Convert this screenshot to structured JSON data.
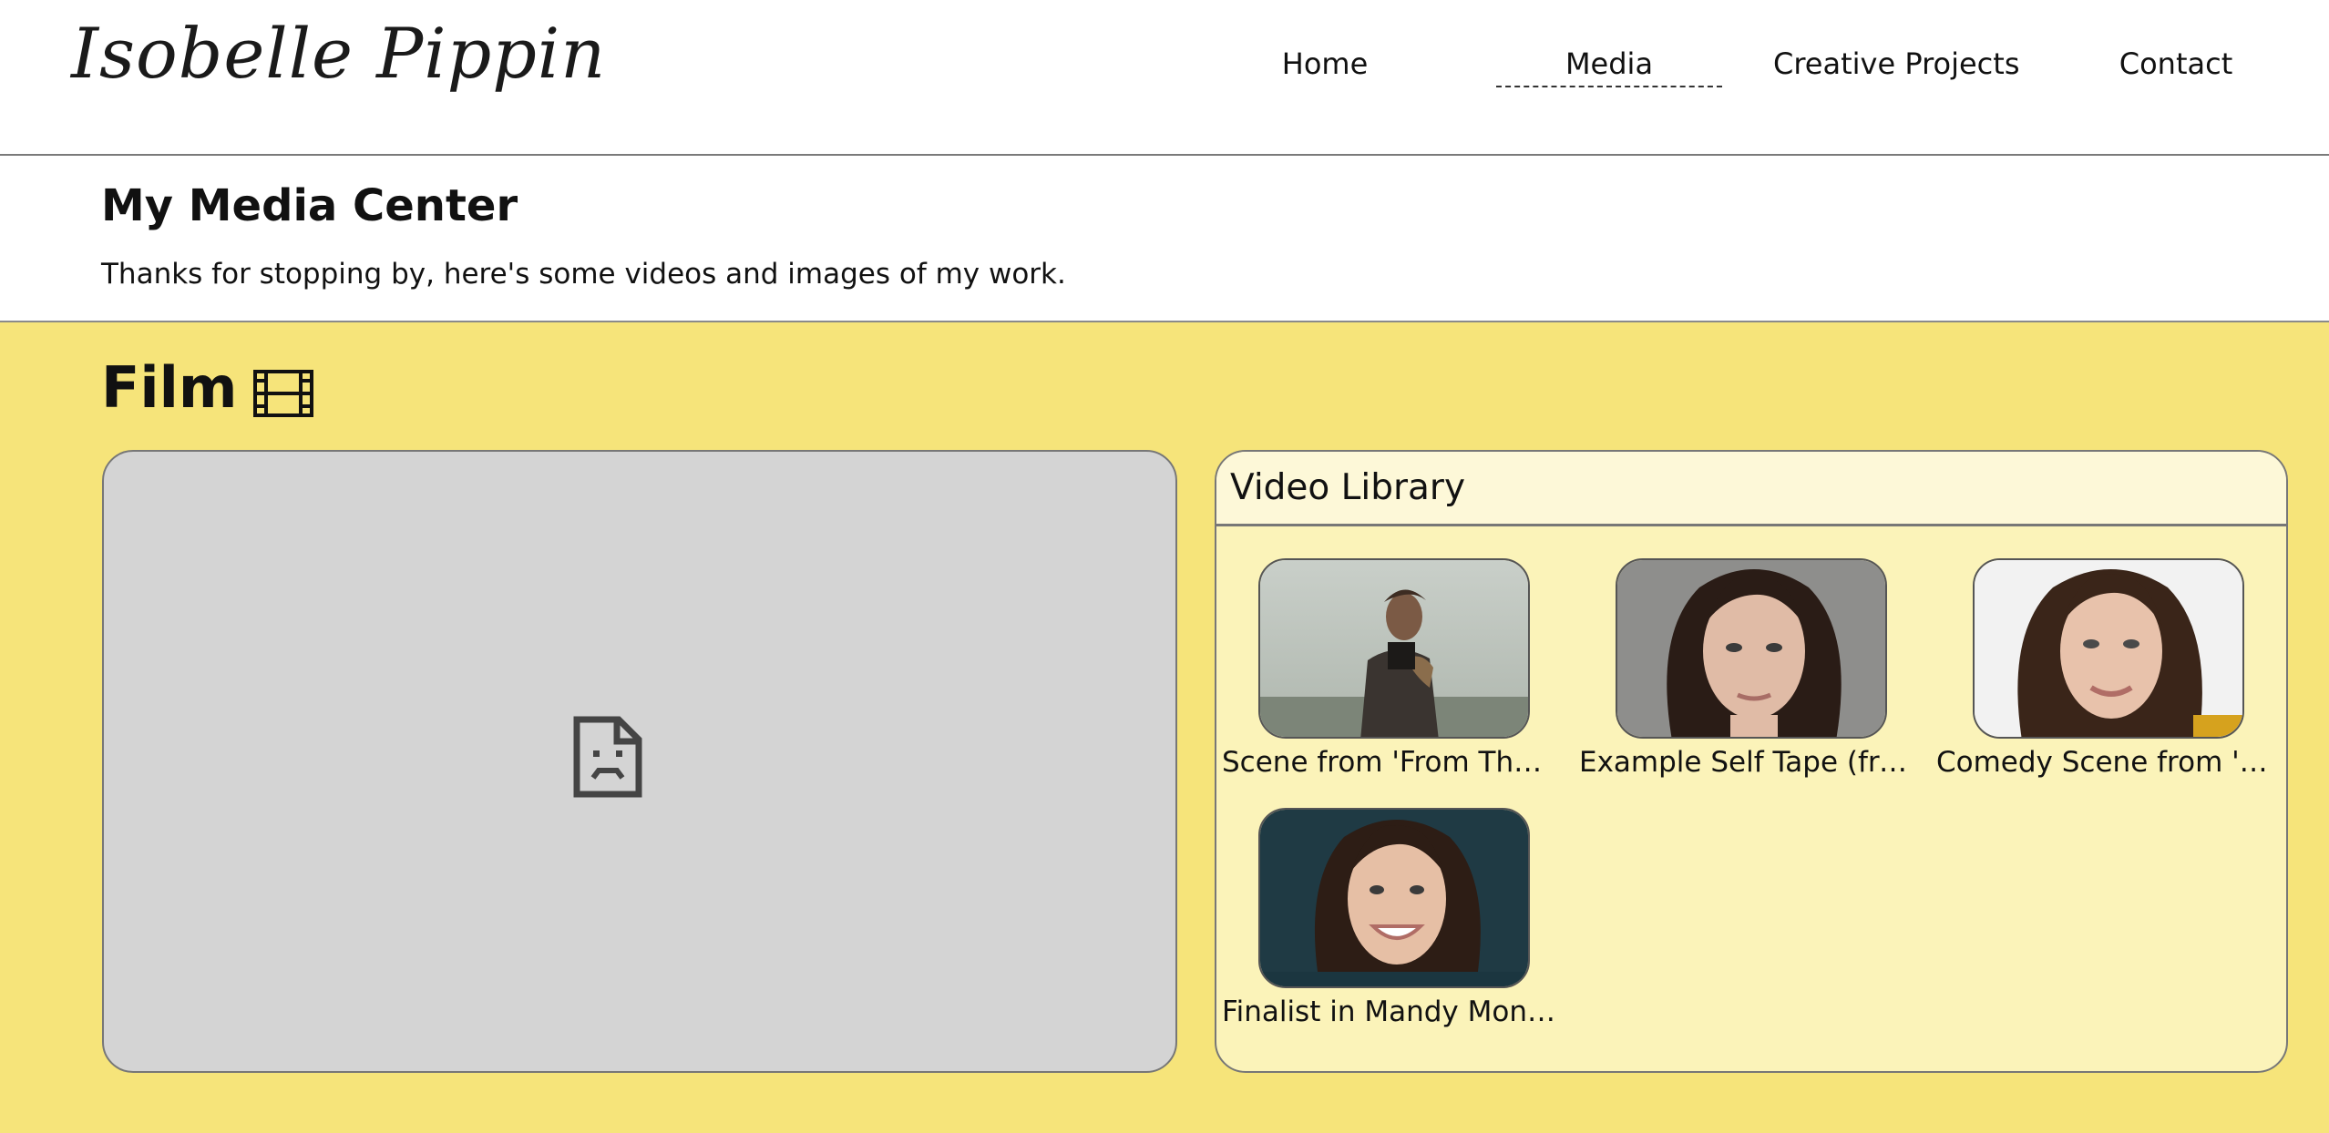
{
  "site": {
    "logo_text": "Isobelle Pippin"
  },
  "nav": {
    "items": [
      {
        "label": "Home"
      },
      {
        "label": "Media"
      },
      {
        "label": "Creative Projects"
      },
      {
        "label": "Contact"
      }
    ],
    "active": "Media"
  },
  "intro": {
    "title": "My Media Center",
    "text": "Thanks for stopping by, here's some videos and images of my work."
  },
  "film": {
    "heading": "Film",
    "icon": "film-icon",
    "player": {
      "state": "broken-content",
      "icon": "broken-page-icon"
    },
    "library": {
      "title": "Video Library",
      "videos": [
        {
          "caption": "Scene from 'From The …"
        },
        {
          "caption": "Example Self Tape (fro…"
        },
        {
          "caption": "Comedy Scene from 'Lo…"
        },
        {
          "caption": "Finalist in Mandy Monol…"
        }
      ]
    }
  },
  "colors": {
    "film_bg": "#f6e47a",
    "library_bg": "#fbf3b9",
    "player_bg": "#d4d4d4"
  }
}
